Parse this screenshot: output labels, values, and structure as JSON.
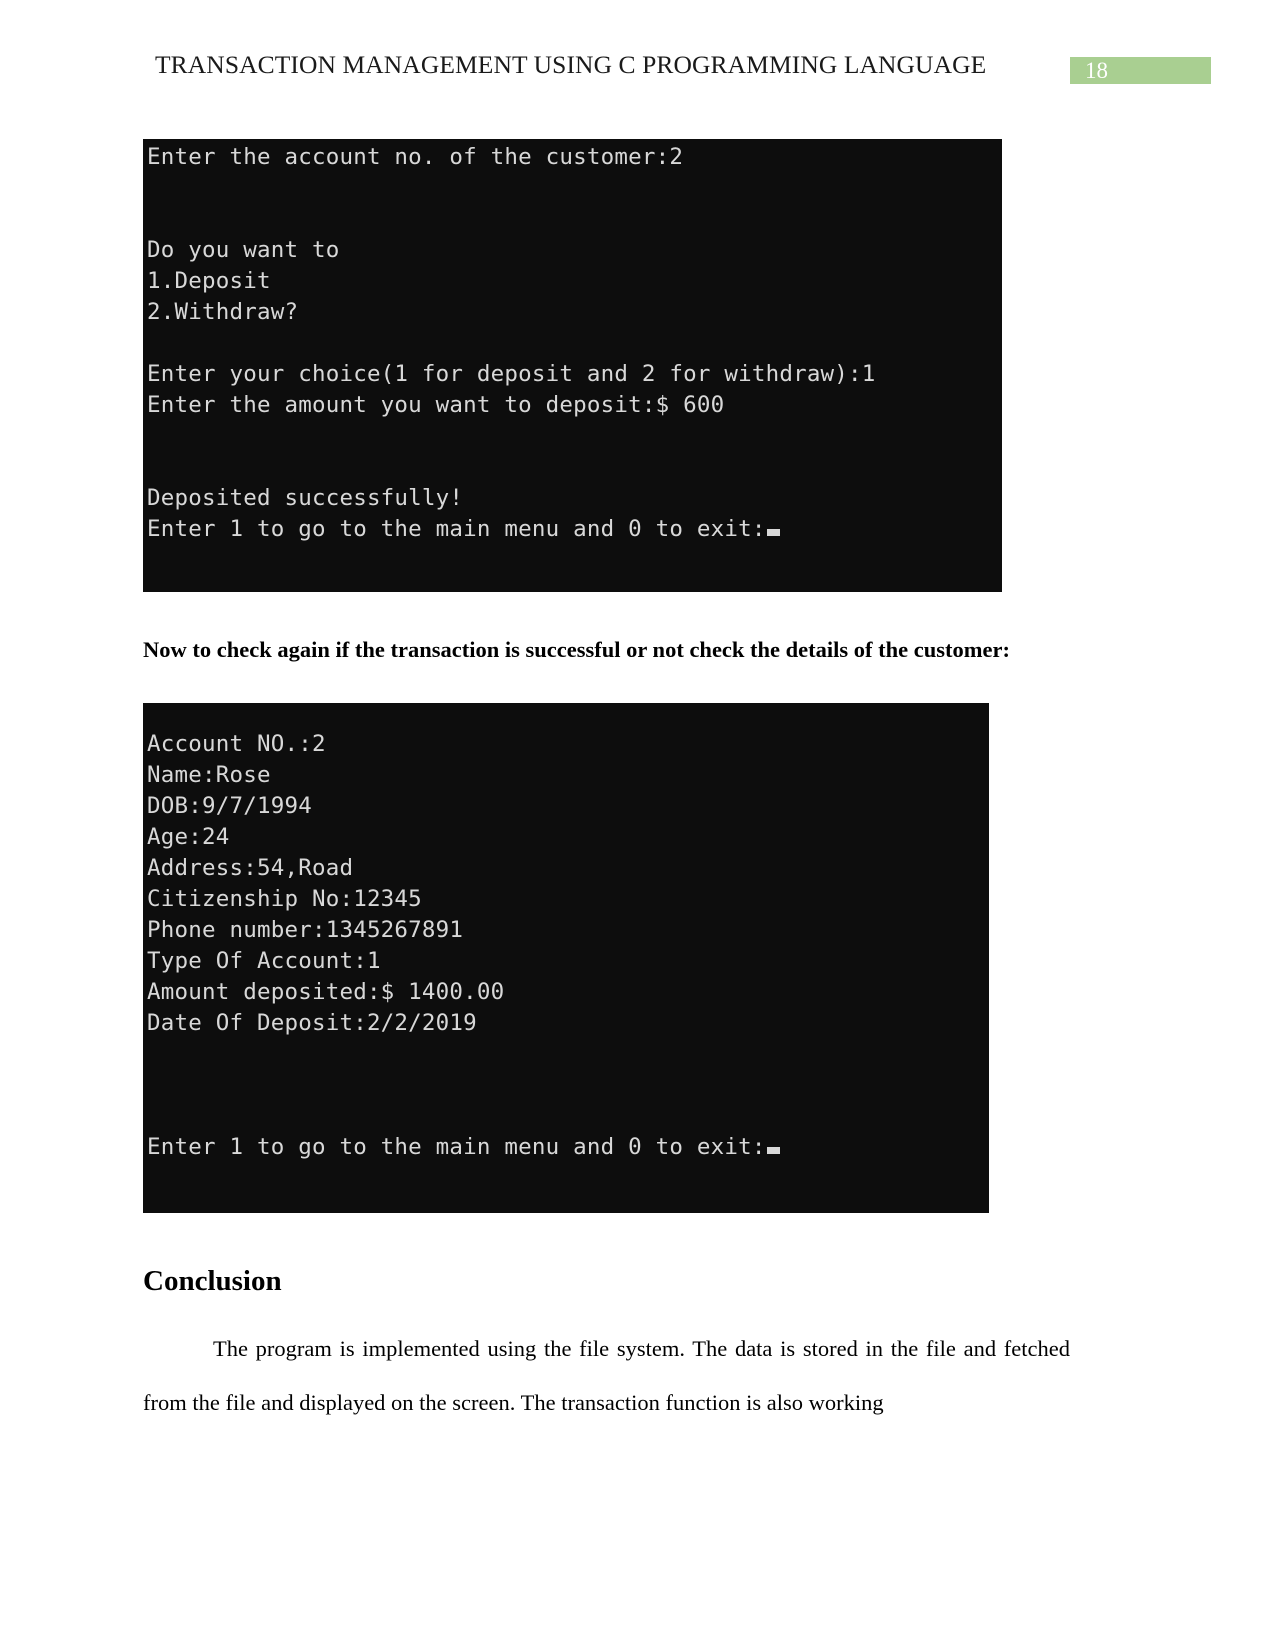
{
  "header": {
    "title": "TRANSACTION MANAGEMENT USING C PROGRAMMING LANGUAGE",
    "page_number": "18",
    "badge_color": "#a9cf91"
  },
  "terminal_one": {
    "background_color": "#0d0d0d",
    "text_color": "#d8d8d8",
    "lines": [
      "Enter the account no. of the customer:2",
      "",
      "",
      "Do you want to",
      "1.Deposit",
      "2.Withdraw?",
      "",
      "Enter your choice(1 for deposit and 2 for withdraw):1",
      "Enter the amount you want to deposit:$ 600",
      "",
      "",
      "Deposited successfully!"
    ],
    "prompt_line": "Enter 1 to go to the main menu and 0 to exit:"
  },
  "caption": {
    "text": "Now to check again if the transaction is successful or not check the details of the customer:"
  },
  "terminal_two": {
    "background_color": "#0d0d0d",
    "text_color": "#d8d8d8",
    "lines": [
      "Account NO.:2",
      "Name:Rose",
      "DOB:9/7/1994",
      "Age:24",
      "Address:54,Road",
      "Citizenship No:12345",
      "Phone number:1345267891",
      "Type Of Account:1",
      "Amount deposited:$ 1400.00",
      "Date Of Deposit:2/2/2019",
      "",
      "",
      ""
    ],
    "prompt_line": "Enter 1 to go to the main menu and 0 to exit:"
  },
  "conclusion": {
    "heading": "Conclusion",
    "paragraph": "The program is implemented using the file system. The data is stored in the file and fetched from the file and displayed on the screen. The transaction function is also working"
  }
}
